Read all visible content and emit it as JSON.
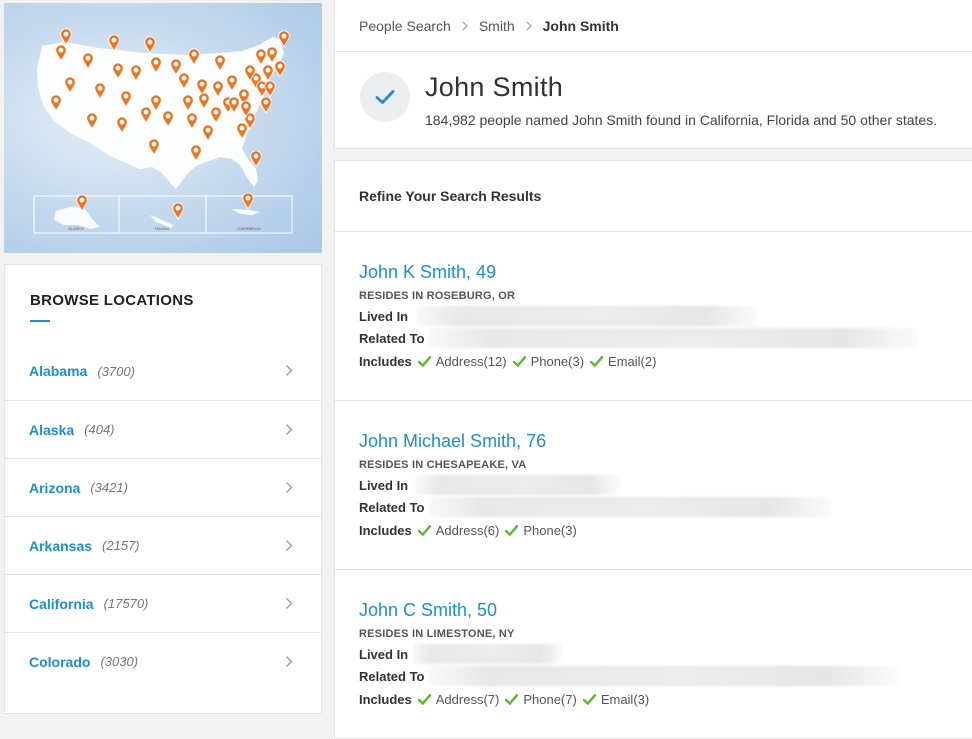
{
  "map": {
    "inset_labels": [
      "ALASKA",
      "HAWAII",
      "CARIBBEAN"
    ]
  },
  "breadcrumb": {
    "items": [
      "People Search",
      "Smith",
      "John Smith"
    ]
  },
  "header": {
    "name": "John Smith",
    "subtitle": "184,982 people named John Smith found in California, Florida and 50 other states."
  },
  "refine": {
    "label": "Refine Your Search Results"
  },
  "browse": {
    "title": "BROWSE LOCATIONS",
    "locations": [
      {
        "name": "Alabama",
        "count": "(3700)"
      },
      {
        "name": "Alaska",
        "count": "(404)"
      },
      {
        "name": "Arizona",
        "count": "(3421)"
      },
      {
        "name": "Arkansas",
        "count": "(2157)"
      },
      {
        "name": "California",
        "count": "(17570)"
      },
      {
        "name": "Colorado",
        "count": "(3030)"
      }
    ]
  },
  "results": [
    {
      "name": "John K Smith, 49",
      "resides": "RESIDES IN ROSEBURG, OR",
      "lived_label": "Lived In",
      "related_label": "Related To",
      "includes_label": "Includes",
      "includes": [
        "Address(12)",
        "Phone(3)",
        "Email(2)"
      ]
    },
    {
      "name": "John Michael Smith, 76",
      "resides": "RESIDES IN CHESAPEAKE, VA",
      "lived_label": "Lived In",
      "related_label": "Related To",
      "includes_label": "Includes",
      "includes": [
        "Address(6)",
        "Phone(3)"
      ]
    },
    {
      "name": "John C Smith, 50",
      "resides": "RESIDES IN LIMESTONE, NY",
      "lived_label": "Lived In",
      "related_label": "Related To",
      "includes_label": "Includes",
      "includes": [
        "Address(7)",
        "Phone(7)",
        "Email(3)"
      ]
    }
  ],
  "colors": {
    "accent_blue": "#1a90d0",
    "pin_orange": "#f0731e",
    "check_green": "#5cb82d"
  }
}
